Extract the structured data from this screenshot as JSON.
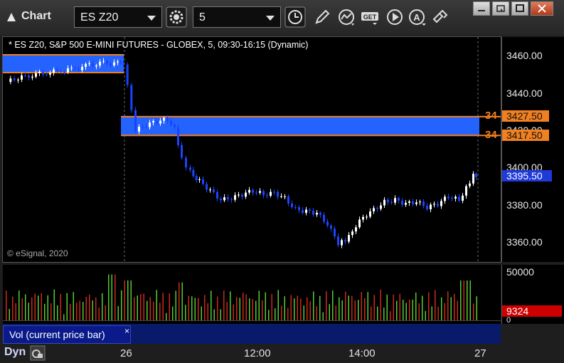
{
  "titlebar": {
    "title": "Chart",
    "symbol_value": "ES Z20",
    "interval_value": "5",
    "colors": {
      "background": "#2a2a2a",
      "text": "#e8e8e8"
    },
    "tools": [
      "clock-icon",
      "pencil-icon",
      "study-icon",
      "get-icon",
      "play-icon",
      "alert-icon",
      "link-icon"
    ],
    "window_buttons": [
      "minimize-icon",
      "restore-icon",
      "maximize-icon",
      "close-icon"
    ]
  },
  "chart": {
    "header": "* ES Z20, S&P 500 E-MINI FUTURES - GLOBEX, 5, 09:30-16:15 (Dynamic)",
    "copyright": "© eSignal, 2020",
    "price_axis": [
      "3460.00",
      "3440.00",
      "3420.00",
      "3400.00",
      "3380.00",
      "3360.00"
    ],
    "price_axis_values": [
      3460,
      3440,
      3420,
      3400,
      3380,
      3360
    ],
    "price_range": [
      3350,
      3470
    ],
    "upper_level": {
      "label": "3427.50",
      "value": 3427.5,
      "side": "34"
    },
    "lower_level": {
      "label": "3417.50",
      "value": 3417.5,
      "side": "34"
    },
    "last_price": {
      "label": "3395.50",
      "value": 3395.5
    },
    "zone_prior": {
      "top": 3460.5,
      "bottom": 3451.0
    },
    "colors": {
      "zone": "#2563ff",
      "level": "#f08020",
      "up": "#ffffff",
      "down": "#1a44ff",
      "last": "#1f3ad8"
    }
  },
  "volume": {
    "label": "Vol (current price bar)",
    "close": "×",
    "axis_top": "50000",
    "axis_zero": "0",
    "current": "9324",
    "current_value": 9324,
    "max": 50000,
    "colors": {
      "up": "#55cc33",
      "down": "#cc2a1a",
      "current": "#cc0000"
    }
  },
  "time_axis": {
    "labels": [
      "26",
      "12:00",
      "14:00",
      "27"
    ]
  },
  "footer": {
    "dyn": "Dyn"
  },
  "chart_data": {
    "type": "candlestick",
    "x_unit": "5-minute bars",
    "ylim": [
      3350,
      3470
    ],
    "volume_ylim": [
      0,
      50000
    ]
  }
}
